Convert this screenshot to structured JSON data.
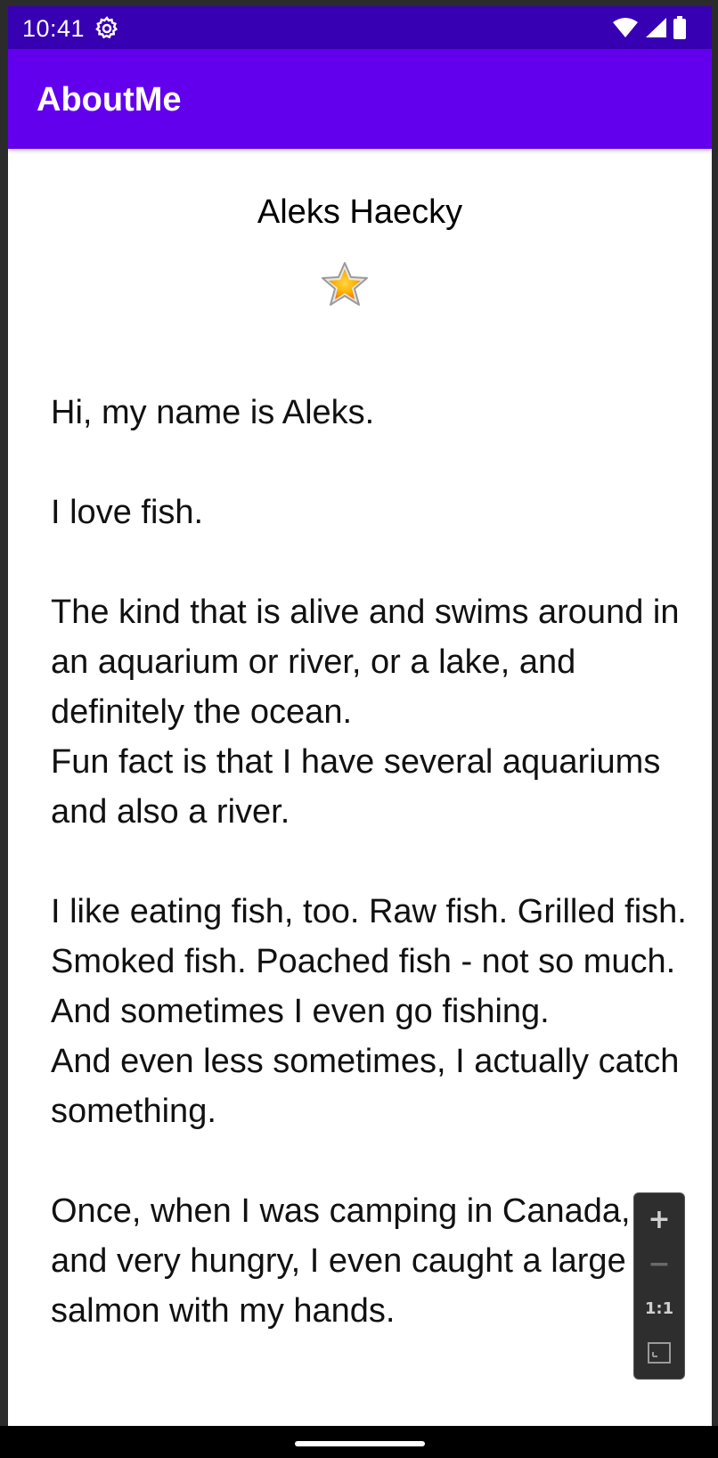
{
  "status_bar": {
    "time": "10:41",
    "icons": [
      "gear-icon",
      "wifi-icon",
      "cellular-signal-icon",
      "battery-icon"
    ],
    "color": "#3700b3"
  },
  "app_bar": {
    "title": "AboutMe",
    "color": "#6200ee"
  },
  "profile": {
    "name": "Aleks Haecky",
    "star_icon": "star-icon"
  },
  "bio": {
    "text": "Hi, my name is Aleks.\n\nI love fish.\n\nThe kind that is alive and swims around in an aquarium or river, or a lake, and definitely the ocean.\nFun fact is that I have several aquariums and also a river.\n\nI like eating fish, too. Raw fish. Grilled fish. Smoked fish. Poached fish - not so much.\nAnd sometimes I even go fishing.\nAnd even less sometimes, I actually catch something.\n\nOnce, when I was camping in Canada, and very hungry, I even caught a large salmon with my hands."
  },
  "zoom_controls": {
    "zoom_in": "+",
    "zoom_out": "−",
    "actual_size": "1:1",
    "fit_icon": "fit-screen-icon"
  }
}
